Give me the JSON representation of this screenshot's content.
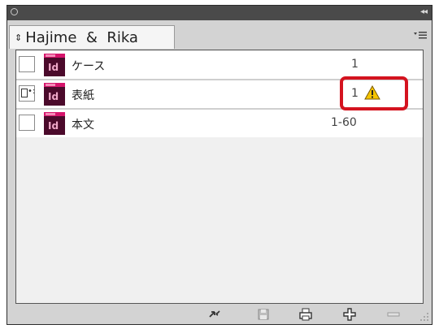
{
  "panel": {
    "tab_label": "Hajime  &  Rika",
    "tab_arrows": "⇕"
  },
  "documents": [
    {
      "name": "ケース",
      "pages": "1",
      "icon": "indesign-doc-icon",
      "sync_source": false,
      "warning": false
    },
    {
      "name": "表紙",
      "pages": "1",
      "icon": "indesign-doc-icon",
      "sync_source": true,
      "warning": true
    },
    {
      "name": "本文",
      "pages": "1-60",
      "icon": "indesign-doc-icon",
      "sync_source": false,
      "warning": false
    }
  ],
  "icon_text": "Id",
  "toolbar": {
    "buttons": [
      "sync-styles-icon",
      "save-book-icon",
      "print-book-icon",
      "add-document-icon",
      "remove-document-icon"
    ]
  },
  "colors": {
    "highlight": "#d4131f",
    "indesign_dark": "#4b0a2b",
    "indesign_pink": "#d6136b",
    "warning_yellow": "#f5c400"
  }
}
